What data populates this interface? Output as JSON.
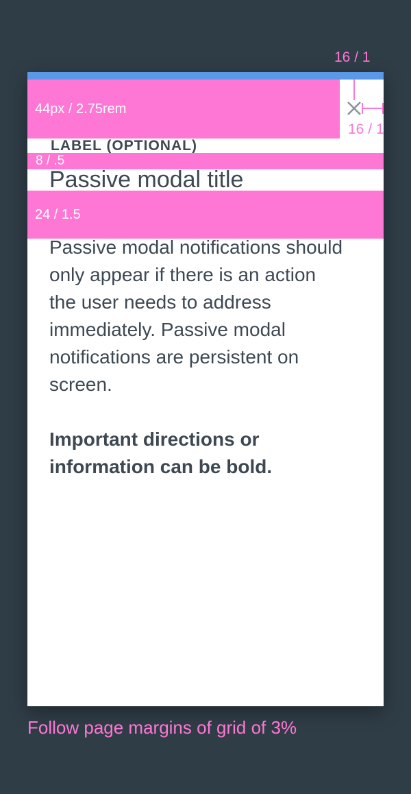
{
  "spec": {
    "top_spacing_label": "16 / 1",
    "side_spacing_label": "16 / 1",
    "header_height_label": "44px / 2.75rem",
    "label_gap_label": "8 / .5",
    "title_gap_label": "24 / 1.5",
    "footer_note": "Follow page margins of grid of 3%"
  },
  "modal": {
    "label": "LABEL (OPTIONAL)",
    "title": "Passive modal title",
    "body": "Passive modal notifications should only appear if there is an action the user needs to address immediately. Passive modal notifications are persistent on screen.",
    "body_bold": "Important directions or information can be bold.",
    "close_icon": "close-icon"
  },
  "colors": {
    "background": "#2f3d47",
    "modal": "#ffffff",
    "accent": "#5a99e8",
    "spec": "#ff77d4",
    "text": "#3d4852",
    "icon": "#8a9199"
  }
}
